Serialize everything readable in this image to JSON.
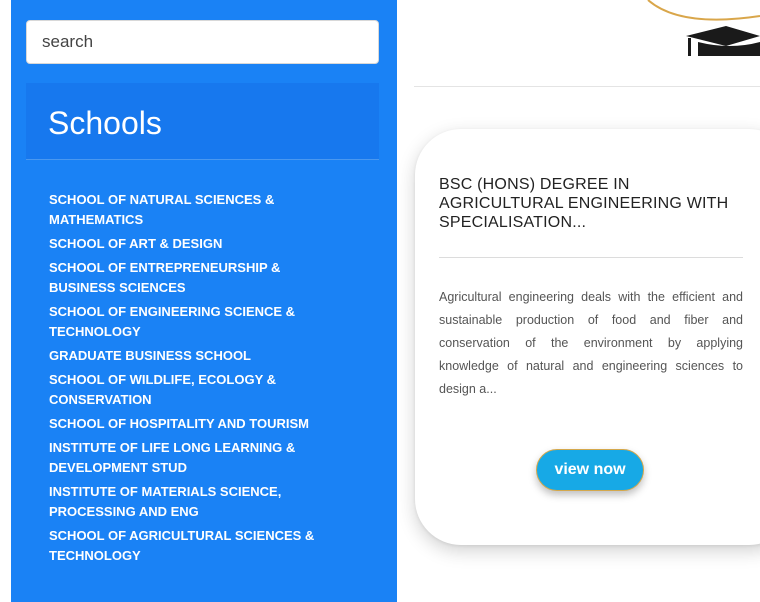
{
  "search": {
    "placeholder": "search"
  },
  "sidebar": {
    "title": "Schools",
    "items": [
      {
        "label": "SCHOOL OF NATURAL SCIENCES & MATHEMATICS"
      },
      {
        "label": "SCHOOL OF ART & DESIGN"
      },
      {
        "label": "SCHOOL OF ENTREPRENEURSHIP & BUSINESS SCIENCES"
      },
      {
        "label": "SCHOOL OF ENGINEERING SCIENCE & TECHNOLOGY"
      },
      {
        "label": "GRADUATE BUSINESS SCHOOL"
      },
      {
        "label": "SCHOOL OF WILDLIFE, ECOLOGY & CONSERVATION"
      },
      {
        "label": "SCHOOL OF HOSPITALITY AND TOURISM"
      },
      {
        "label": "INSTITUTE OF LIFE LONG LEARNING & DEVELOPMENT STUD"
      },
      {
        "label": "INSTITUTE OF MATERIALS SCIENCE, PROCESSING AND ENG"
      },
      {
        "label": "SCHOOL OF AGRICULTURAL SCIENCES & TECHNOLOGY"
      }
    ]
  },
  "header": {
    "logo_icon": "graduation-cap-icon"
  },
  "card": {
    "title": "BSC (HONS) DEGREE IN AGRICULTURAL ENGINEERING WITH SPECIALISATION...",
    "description": "Agricultural engineering deals with the efficient and sustainable production of food and fiber and conservation of the environment by applying knowledge of natural and engineering sciences to design a...",
    "button_label": "view now"
  },
  "colors": {
    "sidebar_bg": "#1a82f5",
    "button_bg": "#17a9e6"
  }
}
